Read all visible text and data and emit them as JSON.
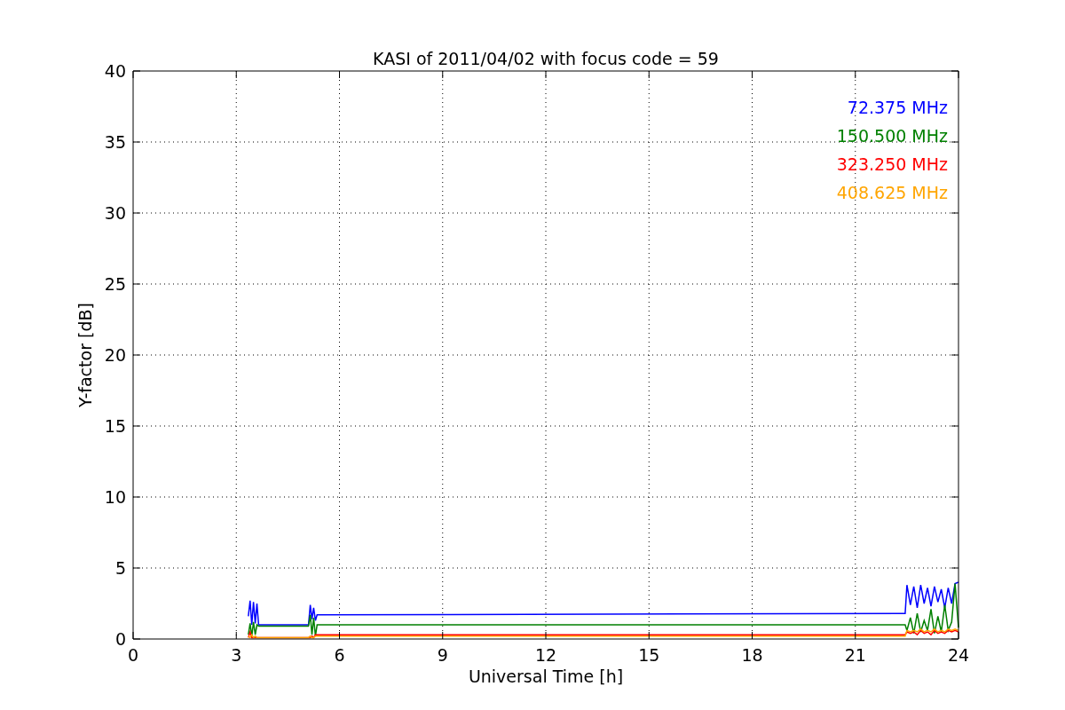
{
  "figure": {
    "chart_data": {
      "type": "line",
      "grid": true,
      "title": "KASI of 2011/04/02 with focus code = 59",
      "xlabel": "Universal Time [h]",
      "ylabel": "Y-factor [dB]",
      "xlim": [
        0,
        24
      ],
      "ylim": [
        0,
        40
      ],
      "xticks": [
        0,
        3,
        6,
        9,
        12,
        15,
        18,
        21,
        24
      ],
      "yticks": [
        0,
        5,
        10,
        15,
        20,
        25,
        30,
        35,
        40
      ],
      "x": [
        3.35,
        3.4,
        3.45,
        3.5,
        3.55,
        3.6,
        3.65,
        5.1,
        5.15,
        5.2,
        5.25,
        5.3,
        5.35,
        22.45,
        22.5,
        22.6,
        22.7,
        22.8,
        22.9,
        23.0,
        23.1,
        23.2,
        23.3,
        23.4,
        23.5,
        23.6,
        23.7,
        23.8,
        23.9,
        24.0
      ],
      "series": [
        {
          "name": "72.375 MHz",
          "color": "#0000ff",
          "values": [
            1.6,
            2.7,
            1.0,
            2.6,
            1.1,
            2.5,
            1.0,
            1.0,
            2.4,
            1.4,
            2.2,
            1.3,
            1.7,
            1.8,
            3.8,
            2.4,
            3.7,
            2.2,
            3.8,
            2.5,
            3.6,
            2.3,
            3.7,
            2.6,
            3.5,
            2.2,
            3.6,
            2.5,
            3.9,
            4.0
          ]
        },
        {
          "name": "150.500 MHz",
          "color": "#008000",
          "values": [
            0.3,
            1.1,
            0.2,
            1.2,
            0.3,
            1.0,
            0.9,
            0.9,
            1.7,
            0.3,
            1.5,
            0.2,
            1.0,
            1.0,
            0.6,
            1.5,
            0.4,
            1.8,
            0.5,
            1.3,
            0.6,
            2.1,
            0.4,
            1.6,
            0.5,
            2.4,
            0.6,
            1.2,
            3.9,
            0.8
          ]
        },
        {
          "name": "323.250 MHz",
          "color": "#ff0000",
          "values": [
            0.1,
            0.5,
            0.1,
            0.1,
            0.1,
            0.1,
            0.1,
            0.1,
            0.1,
            0.2,
            0.1,
            0.3,
            0.3,
            0.3,
            0.5,
            0.4,
            0.5,
            0.3,
            0.6,
            0.4,
            0.5,
            0.3,
            0.6,
            0.4,
            0.5,
            0.4,
            0.6,
            0.5,
            0.6,
            0.5
          ]
        },
        {
          "name": "408.625 MHz",
          "color": "#ffa500",
          "values": [
            0.2,
            0.1,
            0.3,
            0.1,
            0.2,
            0.1,
            0.1,
            0.1,
            0.2,
            0.1,
            0.1,
            0.2,
            0.2,
            0.2,
            0.6,
            0.5,
            0.6,
            0.5,
            0.7,
            0.5,
            0.6,
            0.5,
            0.7,
            0.5,
            0.6,
            0.5,
            0.7,
            0.6,
            0.7,
            0.6
          ]
        }
      ]
    }
  }
}
